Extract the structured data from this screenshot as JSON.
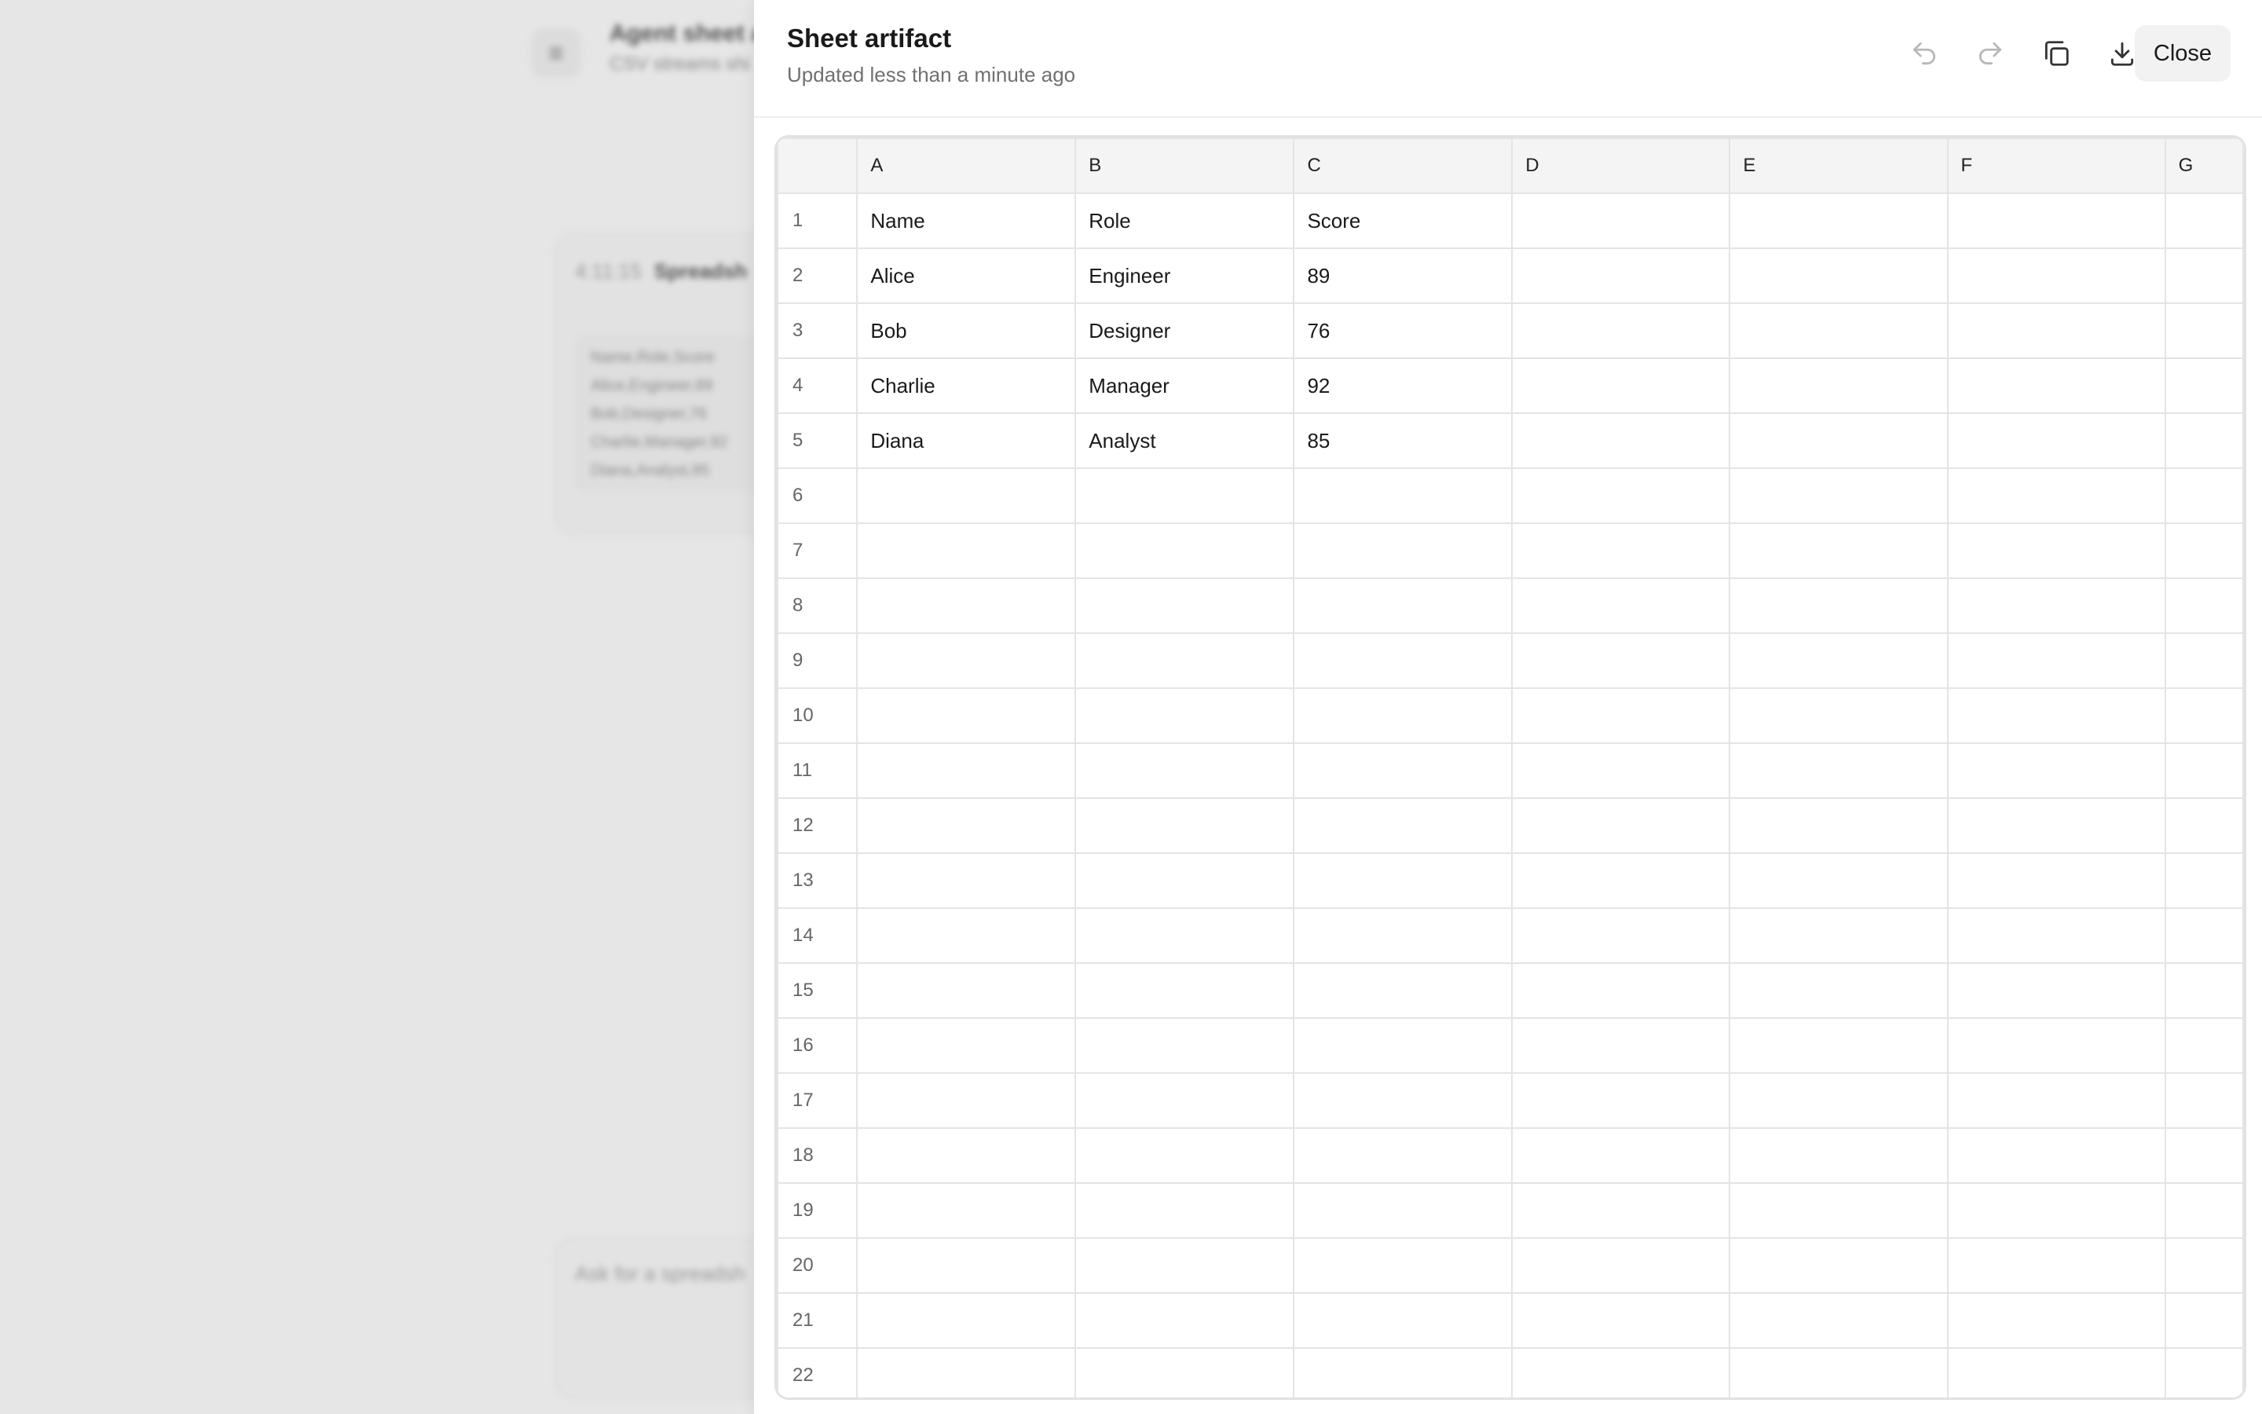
{
  "background": {
    "chat_title": "Agent sheet ai",
    "chat_subtitle": "CSV streams shi",
    "card_time": "4:11:15",
    "card_label": "Spreadsh",
    "card_lines": [
      "Name,Role,Score",
      "Alice,Engineer,89",
      "Bob,Designer,76",
      "Charlie,Manager,92",
      "Diana,Analyst,85"
    ],
    "input_placeholder": "Ask for a spreadsh"
  },
  "panel": {
    "title": "Sheet artifact",
    "subtitle": "Updated less than a minute ago",
    "close_label": "Close",
    "toolbar_icons": [
      "undo-icon",
      "redo-icon",
      "copy-icon",
      "download-icon"
    ]
  },
  "grid": {
    "columns": [
      "A",
      "B",
      "C",
      "D",
      "E",
      "F",
      "G"
    ],
    "row_numbers": [
      "1",
      "2",
      "3",
      "4",
      "5",
      "6",
      "7",
      "8",
      "9",
      "10",
      "11",
      "12",
      "13",
      "14",
      "15",
      "16",
      "17",
      "18",
      "19",
      "20",
      "21",
      "22"
    ],
    "rows": [
      [
        "Name",
        "Role",
        "Score",
        "",
        "",
        "",
        ""
      ],
      [
        "Alice",
        "Engineer",
        "89",
        "",
        "",
        "",
        ""
      ],
      [
        "Bob",
        "Designer",
        "76",
        "",
        "",
        "",
        ""
      ],
      [
        "Charlie",
        "Manager",
        "92",
        "",
        "",
        "",
        ""
      ],
      [
        "Diana",
        "Analyst",
        "85",
        "",
        "",
        "",
        ""
      ],
      [
        "",
        "",
        "",
        "",
        "",
        "",
        ""
      ],
      [
        "",
        "",
        "",
        "",
        "",
        "",
        ""
      ],
      [
        "",
        "",
        "",
        "",
        "",
        "",
        ""
      ],
      [
        "",
        "",
        "",
        "",
        "",
        "",
        ""
      ],
      [
        "",
        "",
        "",
        "",
        "",
        "",
        ""
      ],
      [
        "",
        "",
        "",
        "",
        "",
        "",
        ""
      ],
      [
        "",
        "",
        "",
        "",
        "",
        "",
        ""
      ],
      [
        "",
        "",
        "",
        "",
        "",
        "",
        ""
      ],
      [
        "",
        "",
        "",
        "",
        "",
        "",
        ""
      ],
      [
        "",
        "",
        "",
        "",
        "",
        "",
        ""
      ],
      [
        "",
        "",
        "",
        "",
        "",
        "",
        ""
      ],
      [
        "",
        "",
        "",
        "",
        "",
        "",
        ""
      ],
      [
        "",
        "",
        "",
        "",
        "",
        "",
        ""
      ],
      [
        "",
        "",
        "",
        "",
        "",
        "",
        ""
      ],
      [
        "",
        "",
        "",
        "",
        "",
        "",
        ""
      ],
      [
        "",
        "",
        "",
        "",
        "",
        "",
        ""
      ],
      [
        "",
        "",
        "",
        "",
        "",
        "",
        ""
      ]
    ]
  }
}
